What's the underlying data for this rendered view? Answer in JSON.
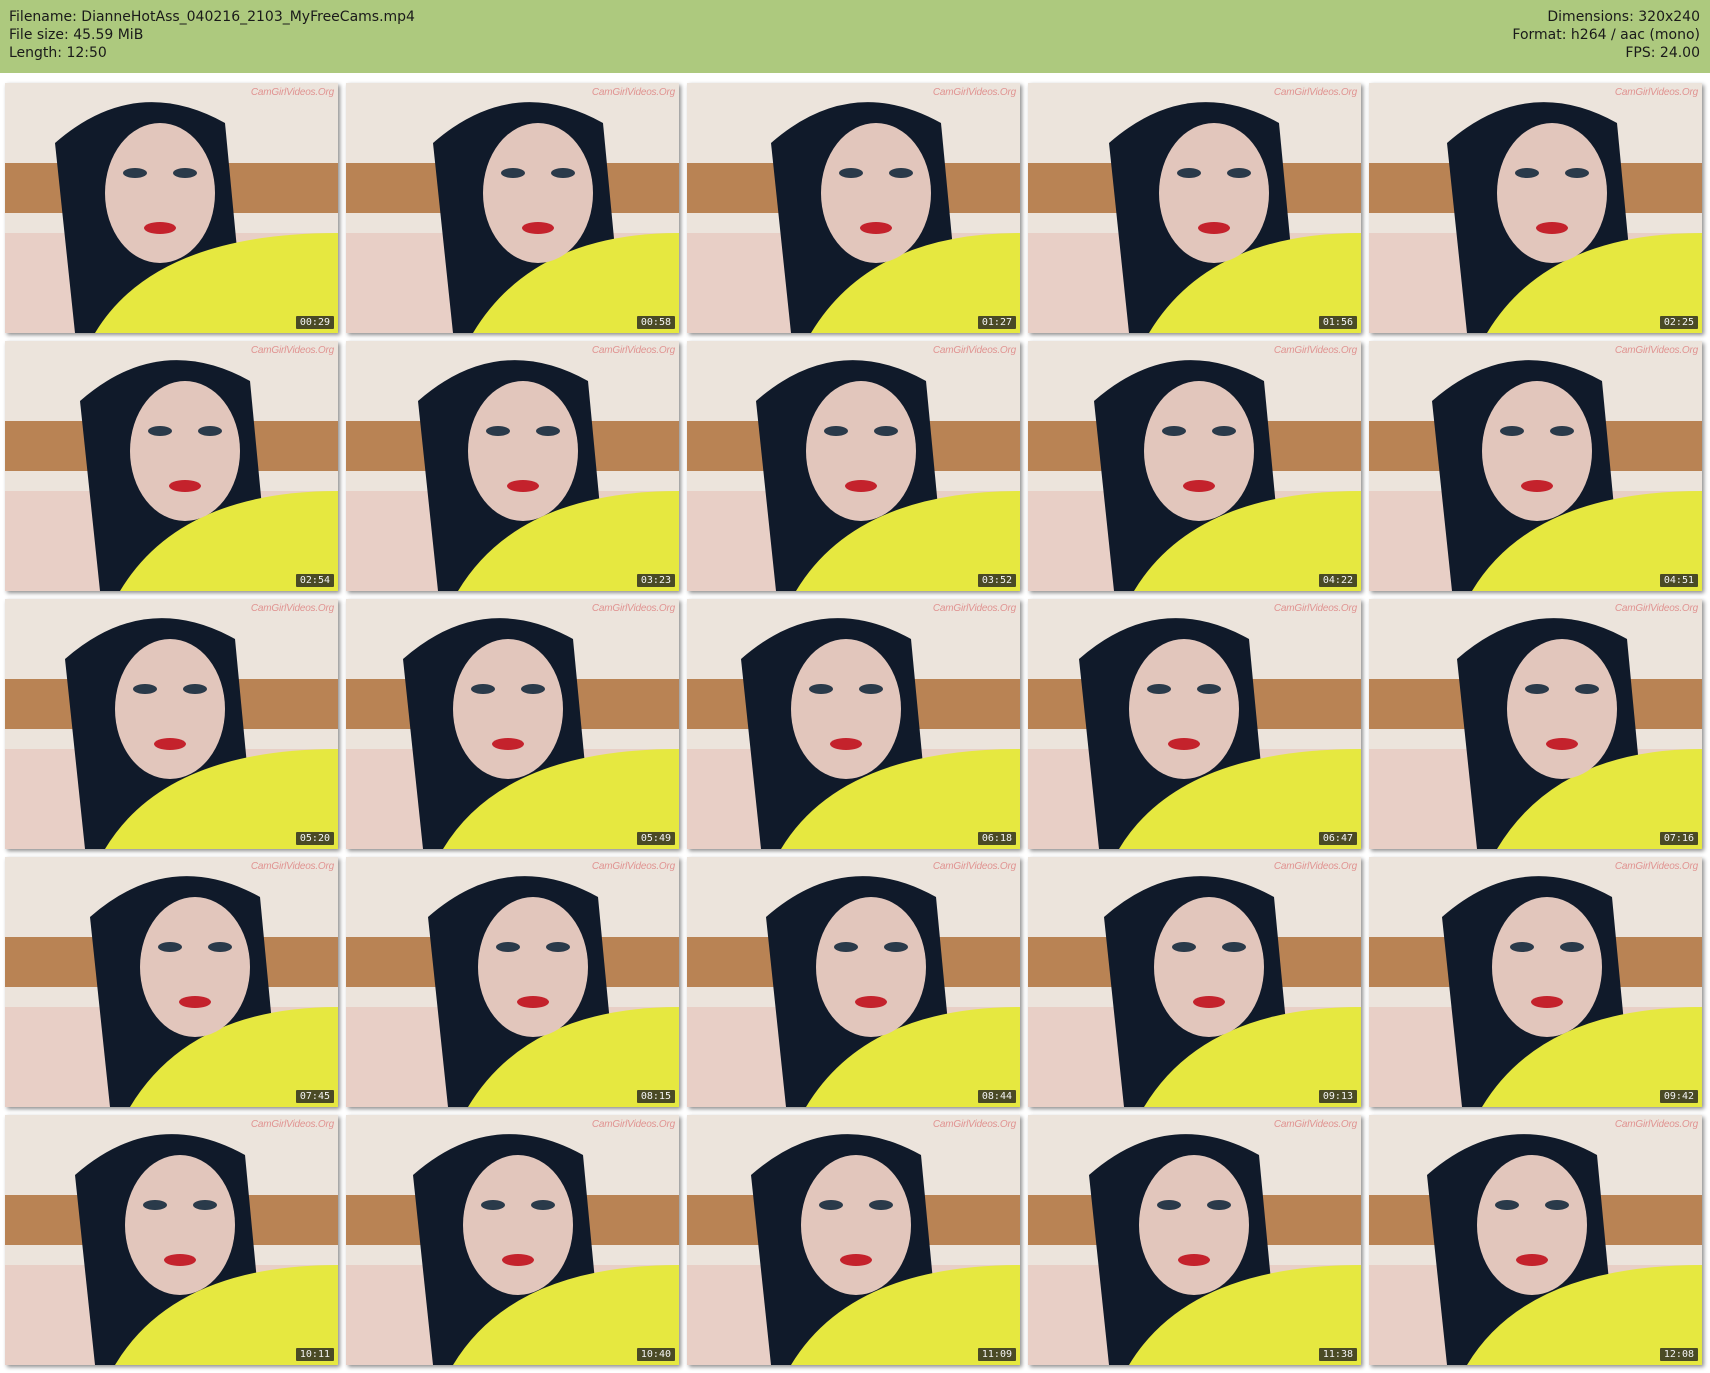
{
  "header": {
    "filename_line": "Filename: DianneHotAss_040216_2103_MyFreeCams.mp4",
    "filesize_line": "File size: 45.59 MiB",
    "length_line": "Length: 12:50",
    "dimensions_line": "Dimensions: 320x240",
    "format_line": "Format: h264 / aac (mono)",
    "fps_line": "FPS: 24.00"
  },
  "colors": {
    "header_bg": "#adc97e",
    "shirt": "#e6e840",
    "hair": "#101a2a",
    "wall": "#ece4dc",
    "headboard": "#b98354"
  },
  "watermark_text": "CamGirlVideos.Org",
  "thumbnails": [
    {
      "timestamp": "00:29"
    },
    {
      "timestamp": "00:58"
    },
    {
      "timestamp": "01:27"
    },
    {
      "timestamp": "01:56"
    },
    {
      "timestamp": "02:25"
    },
    {
      "timestamp": "02:54"
    },
    {
      "timestamp": "03:23"
    },
    {
      "timestamp": "03:52"
    },
    {
      "timestamp": "04:22"
    },
    {
      "timestamp": "04:51"
    },
    {
      "timestamp": "05:20"
    },
    {
      "timestamp": "05:49"
    },
    {
      "timestamp": "06:18"
    },
    {
      "timestamp": "06:47"
    },
    {
      "timestamp": "07:16"
    },
    {
      "timestamp": "07:45"
    },
    {
      "timestamp": "08:15"
    },
    {
      "timestamp": "08:44"
    },
    {
      "timestamp": "09:13"
    },
    {
      "timestamp": "09:42"
    },
    {
      "timestamp": "10:11"
    },
    {
      "timestamp": "10:40"
    },
    {
      "timestamp": "11:09"
    },
    {
      "timestamp": "11:38"
    },
    {
      "timestamp": "12:08"
    }
  ]
}
